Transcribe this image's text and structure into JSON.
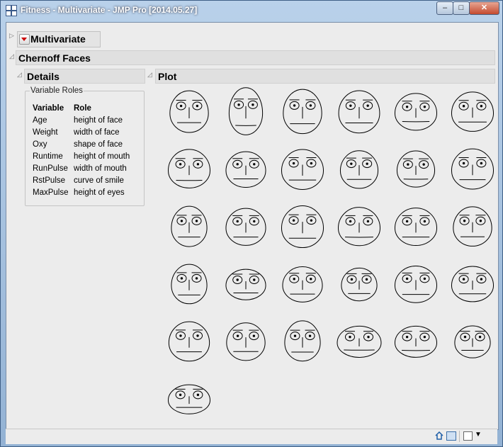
{
  "window": {
    "title": "Fitness - Multivariate - JMP Pro [2014.05.27]",
    "controls": {
      "minimize": "–",
      "maximize": "□",
      "close": "✕"
    }
  },
  "report": {
    "multivariate_label": "Multivariate",
    "chernoff_label": "Chernoff Faces",
    "details_label": "Details",
    "plot_label": "Plot"
  },
  "details": {
    "legend": "Variable Roles",
    "headers": {
      "variable": "Variable",
      "role": "Role"
    },
    "rows": [
      {
        "variable": "Age",
        "role": "height of face"
      },
      {
        "variable": "Weight",
        "role": "width of face"
      },
      {
        "variable": "Oxy",
        "role": "shape of face"
      },
      {
        "variable": "Runtime",
        "role": "height of mouth"
      },
      {
        "variable": "RunPulse",
        "role": "width of mouth"
      },
      {
        "variable": "RstPulse",
        "role": "curve of smile"
      },
      {
        "variable": "MaxPulse",
        "role": "height of eyes"
      }
    ]
  },
  "plot": {
    "face_count": 31,
    "columns": 6,
    "stroke_color": "#000000",
    "faces": [
      {
        "fh": 0.85,
        "fw": 0.92,
        "sh": 0.3,
        "mh": 0.55,
        "mw": 0.45,
        "cv": 0.0,
        "eh": 0.3
      },
      {
        "fh": 0.95,
        "fw": 0.8,
        "sh": 0.35,
        "mh": 0.7,
        "mw": 0.45,
        "cv": 0.1,
        "eh": 0.25
      },
      {
        "fh": 0.9,
        "fw": 0.92,
        "sh": 0.3,
        "mh": 0.6,
        "mw": 0.5,
        "cv": 0.0,
        "eh": 0.3
      },
      {
        "fh": 0.88,
        "fw": 0.98,
        "sh": 0.2,
        "mh": 0.55,
        "mw": 0.55,
        "cv": 0.0,
        "eh": 0.3
      },
      {
        "fh": 0.75,
        "fw": 1.0,
        "sh": 0.3,
        "mh": 0.55,
        "mw": 0.5,
        "cv": 0.1,
        "eh": 0.3
      },
      {
        "fh": 0.8,
        "fw": 1.0,
        "sh": 0.3,
        "mh": 0.55,
        "mw": 0.55,
        "cv": 0.0,
        "eh": 0.25
      },
      {
        "fh": 0.75,
        "fw": 1.0,
        "sh": 0.5,
        "mh": 0.7,
        "mw": 0.45,
        "cv": 0.1,
        "eh": 0.3
      },
      {
        "fh": 0.75,
        "fw": 0.95,
        "sh": 0.15,
        "mh": 0.55,
        "mw": 0.45,
        "cv": 0.0,
        "eh": 0.3
      },
      {
        "fh": 0.85,
        "fw": 1.0,
        "sh": 0.1,
        "mh": 0.55,
        "mw": 0.5,
        "cv": 0.0,
        "eh": 0.3
      },
      {
        "fh": 0.8,
        "fw": 0.9,
        "sh": 0.1,
        "mh": 0.55,
        "mw": 0.5,
        "cv": 0.0,
        "eh": 0.3
      },
      {
        "fh": 0.72,
        "fw": 0.9,
        "sh": 0.4,
        "mh": 0.6,
        "mw": 0.5,
        "cv": 0.1,
        "eh": 0.3
      },
      {
        "fh": 0.82,
        "fw": 1.0,
        "sh": 0.3,
        "mh": 0.55,
        "mw": 0.45,
        "cv": 0.0,
        "eh": 0.25
      },
      {
        "fh": 0.82,
        "fw": 0.85,
        "sh": 0.3,
        "mh": 0.55,
        "mw": 0.45,
        "cv": 0.0,
        "eh": 0.3
      },
      {
        "fh": 0.78,
        "fw": 0.95,
        "sh": 0.15,
        "mh": 0.6,
        "mw": 0.45,
        "cv": 0.0,
        "eh": 0.3
      },
      {
        "fh": 0.88,
        "fw": 1.0,
        "sh": 0.15,
        "mh": 0.6,
        "mw": 0.5,
        "cv": 0.0,
        "eh": 0.3
      },
      {
        "fh": 0.78,
        "fw": 1.0,
        "sh": 0.3,
        "mh": 0.6,
        "mw": 0.55,
        "cv": 0.1,
        "eh": 0.3
      },
      {
        "fh": 0.78,
        "fw": 1.0,
        "sh": 0.2,
        "mh": 0.6,
        "mw": 0.5,
        "cv": 0.0,
        "eh": 0.3
      },
      {
        "fh": 0.8,
        "fw": 0.92,
        "sh": 0.3,
        "mh": 0.55,
        "mw": 0.45,
        "cv": 0.0,
        "eh": 0.25
      },
      {
        "fh": 0.82,
        "fw": 0.85,
        "sh": 0.2,
        "mh": 0.6,
        "mw": 0.45,
        "cv": 0.0,
        "eh": 0.3
      },
      {
        "fh": 0.65,
        "fw": 0.95,
        "sh": 0.1,
        "mh": 0.6,
        "mw": 0.45,
        "cv": 0.0,
        "eh": 0.3
      },
      {
        "fh": 0.75,
        "fw": 0.95,
        "sh": 0.1,
        "mh": 0.6,
        "mw": 0.45,
        "cv": 0.0,
        "eh": 0.3
      },
      {
        "fh": 0.7,
        "fw": 0.85,
        "sh": 0.1,
        "mh": 0.6,
        "mw": 0.45,
        "cv": 0.0,
        "eh": 0.3
      },
      {
        "fh": 0.78,
        "fw": 1.0,
        "sh": 0.1,
        "mh": 0.6,
        "mw": 0.5,
        "cv": 0.0,
        "eh": 0.3
      },
      {
        "fh": 0.72,
        "fw": 1.0,
        "sh": 0.3,
        "mh": 0.6,
        "mw": 0.5,
        "cv": 0.0,
        "eh": 0.3
      },
      {
        "fh": 0.82,
        "fw": 0.97,
        "sh": 0.2,
        "mh": 0.55,
        "mw": 0.45,
        "cv": 0.0,
        "eh": 0.3
      },
      {
        "fh": 0.8,
        "fw": 0.92,
        "sh": 0.1,
        "mh": 0.55,
        "mw": 0.5,
        "cv": 0.0,
        "eh": 0.3
      },
      {
        "fh": 0.8,
        "fw": 0.85,
        "sh": 0.4,
        "mh": 0.6,
        "mw": 0.45,
        "cv": 0.0,
        "eh": 0.3
      },
      {
        "fh": 0.65,
        "fw": 1.05,
        "sh": 0.2,
        "mh": 0.55,
        "mw": 0.6,
        "cv": 0.1,
        "eh": 0.25
      },
      {
        "fh": 0.65,
        "fw": 1.0,
        "sh": 0.2,
        "mh": 0.6,
        "mw": 0.55,
        "cv": 0.1,
        "eh": 0.25
      },
      {
        "fh": 0.68,
        "fw": 0.85,
        "sh": 0.1,
        "mh": 0.55,
        "mw": 0.45,
        "cv": 0.0,
        "eh": 0.3
      },
      {
        "fh": 0.62,
        "fw": 1.0,
        "sh": 0.1,
        "mh": 0.6,
        "mw": 0.45,
        "cv": 0.0,
        "eh": 0.3
      }
    ]
  },
  "statusbar": {
    "icons": [
      "home-icon",
      "window-list-icon",
      "checkbox-icon",
      "dropdown-arrow-icon"
    ]
  }
}
